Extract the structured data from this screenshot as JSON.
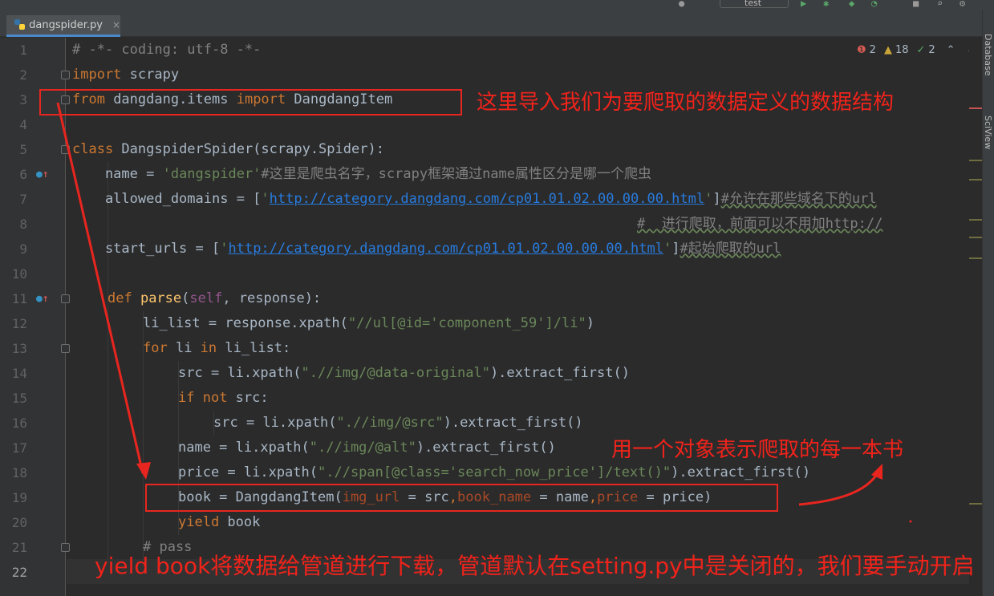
{
  "toolbar": {
    "run_config": "test"
  },
  "tab": {
    "label": "dangspider.py",
    "close": "×"
  },
  "inspections": {
    "errors": "2",
    "warnings": "18",
    "weak": "2"
  },
  "right_strip": {
    "database": "Database",
    "sciview": "SciView"
  },
  "code": {
    "l1": "# -*- coding: utf-8 -*-",
    "l2_kw": "import",
    "l2_rest": " scrapy",
    "l3_kw1": "from",
    "l3_mod": " dangdang.items ",
    "l3_kw2": "import",
    "l3_cls": " DangdangItem",
    "l5_kw": "class",
    "l5_rest": " DangspiderSpider(scrapy.Spider):",
    "l6_a": "    name = ",
    "l6_str": "'dangspider'",
    "l6_cmt": "#这里是爬虫名字，scrapy框架通过name属性区分是哪一个爬虫",
    "l7_a": "    allowed_domains = [",
    "l7_q1": "'",
    "l7_url": "http://category.dangdang.com/cp01.01.02.00.00.00.html",
    "l7_q2": "'",
    "l7_b": "]",
    "l7_cmt": "#允许在那些域名下的url",
    "l8_cmt": "#  进行爬取，前面可以不用加http://",
    "l9_a": "    start_urls = [",
    "l9_q1": "'",
    "l9_url": "http://category.dangdang.com/cp01.01.02.00.00.00.html",
    "l9_q2": "'",
    "l9_b": "]",
    "l9_cmt": "#起始爬取的url",
    "l11_kw": "def",
    "l11_fn": " parse",
    "l11_p1": "(",
    "l11_self": "self",
    "l11_p2": ", response):",
    "l12_a": "li_list = response.xpath(",
    "l12_str": "\"//ul[@id='component_59']/li\"",
    "l12_b": ")",
    "l13_kw1": "for",
    "l13_a": " li ",
    "l13_kw2": "in",
    "l13_b": " li_list:",
    "l14_a": "src = li.xpath(",
    "l14_str": "\".//img/@data-original\"",
    "l14_b": ").extract_first()",
    "l15_kw1": "if",
    "l15_kw2": " not",
    "l15_b": " src:",
    "l16_a": "src = li.xpath(",
    "l16_str": "\".//img/@src\"",
    "l16_b": ").extract_first()",
    "l17_a": "name = li.xpath(",
    "l17_str": "\".//img/@alt\"",
    "l17_b": ").extract_first()",
    "l18_a": "price = li.xpath(",
    "l18_str": "\".//span[@class='search_now_price']/text()\"",
    "l18_b": ").extract_first()",
    "l19_a": "book = DangdangItem(",
    "l19_n1": "img_url",
    "l19_e1": " = src",
    "l19_c1": ",",
    "l19_n2": "book_name",
    "l19_e2": " = name",
    "l19_c2": ",",
    "l19_n3": "price",
    "l19_e3": " = price)",
    "l20_kw": "yield",
    "l20_rest": " book",
    "l21_cmt": "# pass"
  },
  "annotations": {
    "import_note": "这里导入我们为要爬取的数据定义的数据结构",
    "object_note": "用一个对象表示爬取的每一本书",
    "yield_note": "yield book将数据给管道进行下载，管道默认在setting.py中是关闭的，我们要手动开启"
  }
}
